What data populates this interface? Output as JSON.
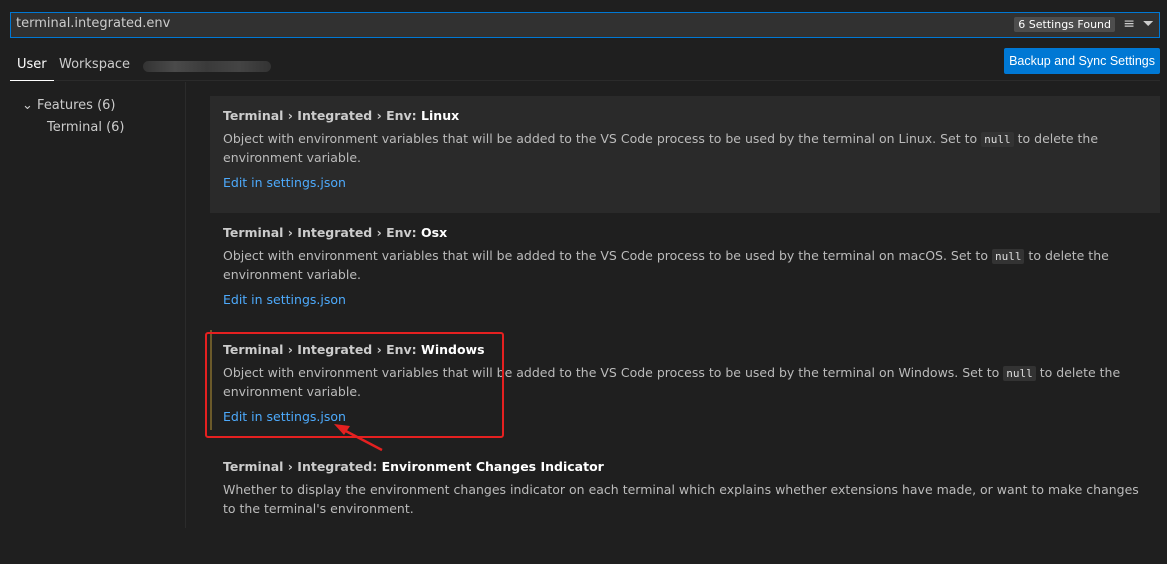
{
  "search": {
    "value": "terminal.integrated.env",
    "count": "6 Settings Found"
  },
  "tabs": {
    "user": "User",
    "workspace": "Workspace"
  },
  "sync_button": "Backup and Sync Settings",
  "sidebar": {
    "features": "Features (6)",
    "terminal": "Terminal (6)"
  },
  "settings": [
    {
      "prefix": "Terminal › Integrated › Env: ",
      "name": "Linux",
      "desc_before": "Object with environment variables that will be added to the VS Code process to be used by the terminal on Linux. Set to ",
      "code": "null",
      "desc_after": " to delete the environment variable.",
      "link": "Edit in settings.json"
    },
    {
      "prefix": "Terminal › Integrated › Env: ",
      "name": "Osx",
      "desc_before": "Object with environment variables that will be added to the VS Code process to be used by the terminal on macOS. Set to ",
      "code": "null",
      "desc_after": " to delete the environment variable.",
      "link": "Edit in settings.json"
    },
    {
      "prefix": "Terminal › Integrated › Env: ",
      "name": "Windows",
      "desc_before": "Object with environment variables that will be added to the VS Code process to be used by the terminal on Windows. Set to ",
      "code": "null",
      "desc_after": " to delete the environment variable.",
      "link": "Edit in settings.json"
    },
    {
      "prefix": "Terminal › Integrated: ",
      "name": "Environment Changes Indicator",
      "desc_before": "Whether to display the environment changes indicator on each terminal which explains whether extensions have made, or want to make changes to the terminal's environment."
    }
  ],
  "colors": {
    "accent": "#0078d4",
    "annotation": "#e52020",
    "link": "#4daafc"
  }
}
